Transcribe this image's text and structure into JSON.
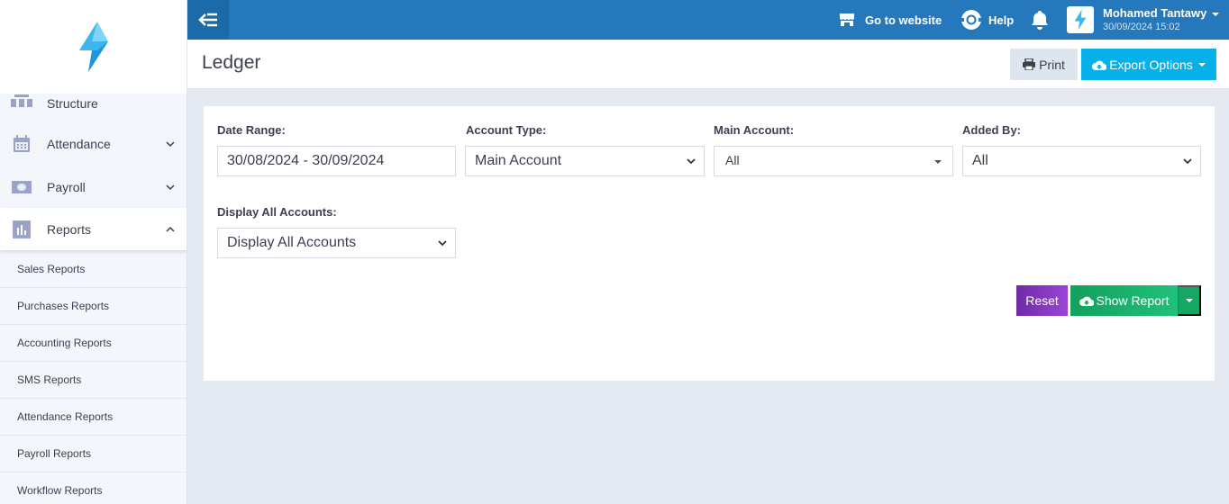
{
  "sidebar": {
    "partial_item": {
      "label": "Structure",
      "icon": "org-structure-icon"
    },
    "items": [
      {
        "label": "Attendance",
        "icon": "calendar-icon",
        "expanded": false
      },
      {
        "label": "Payroll",
        "icon": "money-icon",
        "expanded": false
      },
      {
        "label": "Reports",
        "icon": "bar-chart-icon",
        "expanded": true
      }
    ],
    "sub_items": [
      "Sales Reports",
      "Purchases Reports",
      "Accounting Reports",
      "SMS Reports",
      "Attendance Reports",
      "Payroll Reports",
      "Workflow Reports"
    ]
  },
  "topbar": {
    "go_to_website": "Go to website",
    "help": "Help",
    "user_name": "Mohamed Tantawy",
    "user_datetime": "30/09/2024 15:02"
  },
  "header": {
    "title": "Ledger",
    "print_label": "Print",
    "export_label": "Export Options"
  },
  "filters": {
    "date_range": {
      "label": "Date Range:",
      "value": "30/08/2024 - 30/09/2024"
    },
    "account_type": {
      "label": "Account Type:",
      "value": "Main Account"
    },
    "main_account": {
      "label": "Main Account:",
      "value": "All"
    },
    "added_by": {
      "label": "Added By:",
      "value": "All"
    },
    "display_all": {
      "label": "Display All Accounts:",
      "value": "Display All Accounts"
    }
  },
  "actions": {
    "reset_label": "Reset",
    "show_report_label": "Show Report"
  },
  "colors": {
    "topbar": "#2478bb",
    "export": "#08b0e8",
    "reset": "#7b32b8",
    "show_report": "#17ad68"
  }
}
